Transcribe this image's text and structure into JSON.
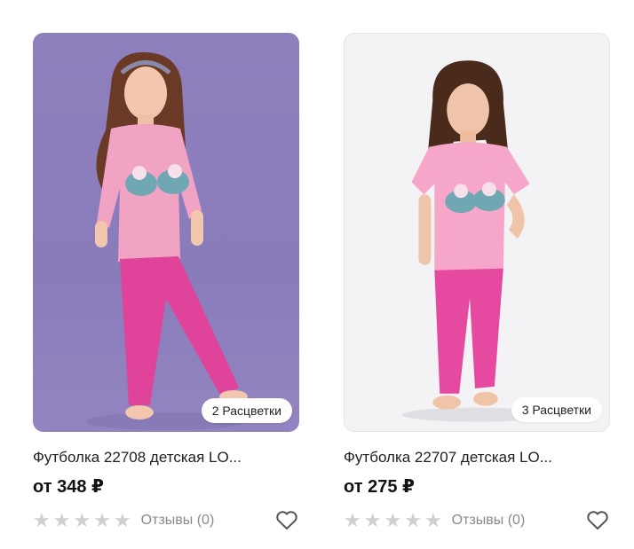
{
  "products": [
    {
      "title": "Футболка 22708 детская LO...",
      "price": "от 348 ₽",
      "colors_badge": "2 Расцветки",
      "rating": 0,
      "reviews": "Отзывы (0)",
      "image": "girl-pink-longsleeve-purple-bg",
      "favorite_icon": "heart-outline-icon"
    },
    {
      "title": "Футболка 22707 детская LO...",
      "price": "от 275 ₽",
      "colors_badge": "3 Расцветки",
      "rating": 0,
      "reviews": "Отзывы (0)",
      "image": "girl-pink-tshirt-light-bg",
      "favorite_icon": "heart-outline-icon"
    }
  ],
  "colors": {
    "star_inactive": "#d0d0d0",
    "photo1_bg": "#8e7fbd",
    "photo2_bg": "#f3f3f5",
    "shirt_pink": "#f1a3c3",
    "leggings_pink": "#e0449a"
  }
}
